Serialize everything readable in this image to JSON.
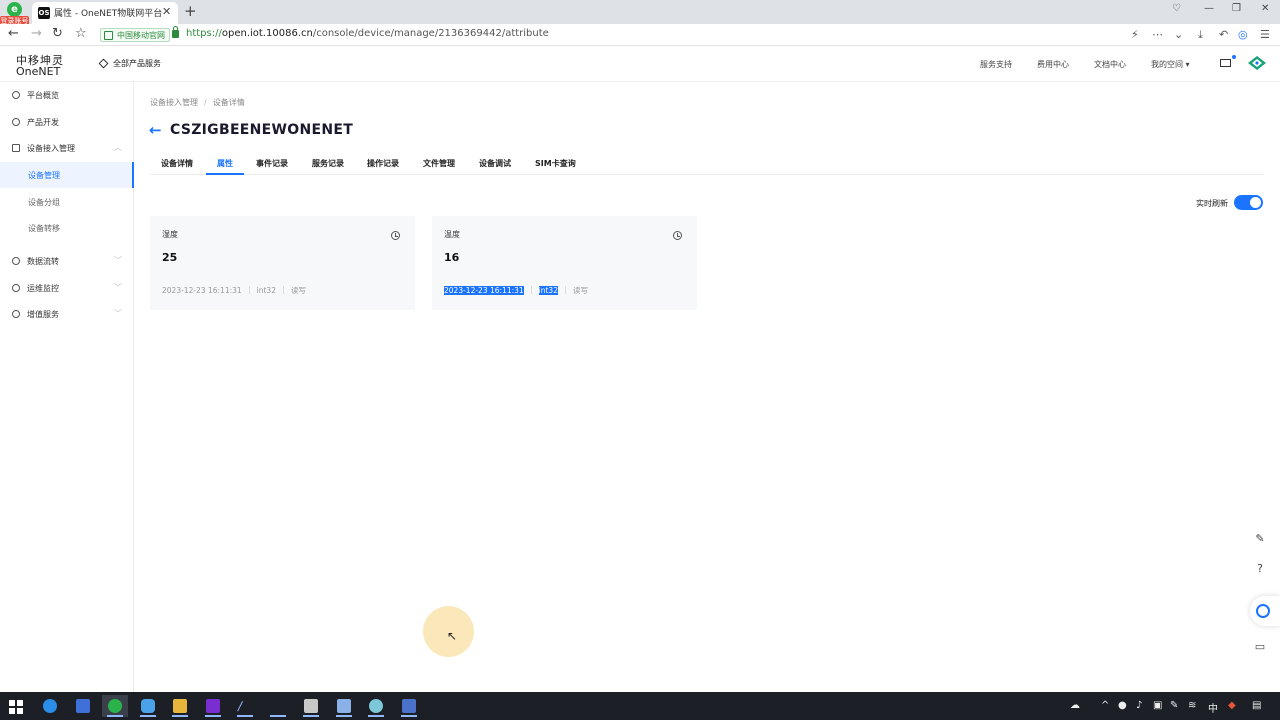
{
  "browser": {
    "login_badge": "登录账号",
    "tab_title": "属性 - OneNET物联网平台",
    "favicon_text": "OS",
    "new_tab": "+",
    "tab_close": "✕",
    "window_controls": [
      "♡",
      "—",
      "❐",
      "✕"
    ],
    "cmcc_label": "中国移动官网",
    "url_scheme": "https://",
    "url_host": "open.iot.10086.cn",
    "url_path": "/console/device/manage/2136369442/attribute"
  },
  "header": {
    "logo_top": "中移坤灵",
    "logo_bottom": "OneNET",
    "all_products": "全部产品服务",
    "links": [
      "服务支持",
      "费用中心",
      "文档中心",
      "我的空间 ▾"
    ]
  },
  "sidebar": {
    "items": [
      {
        "label": "平台概览",
        "icon": "dashboard-icon"
      },
      {
        "label": "产品开发",
        "icon": "product-icon"
      },
      {
        "label": "设备接入管理",
        "icon": "device-icon",
        "expanded": true
      },
      {
        "label": "数据流转",
        "icon": "data-flow-icon"
      },
      {
        "label": "运维监控",
        "icon": "monitor-icon"
      },
      {
        "label": "增值服务",
        "icon": "value-added-icon"
      }
    ],
    "sub_items": [
      {
        "label": "设备管理",
        "active": true
      },
      {
        "label": "设备分组",
        "active": false
      },
      {
        "label": "设备转移",
        "active": false
      }
    ]
  },
  "breadcrumb": {
    "parent": "设备接入管理",
    "sep": "/",
    "current": "设备详情"
  },
  "device": {
    "name": "CSZIGBEENEWONENET"
  },
  "tabs": [
    "设备详情",
    "属性",
    "事件记录",
    "服务记录",
    "操作记录",
    "文件管理",
    "设备调试",
    "SIM卡查询"
  ],
  "active_tab": "属性",
  "realtime": {
    "label": "实时刷新",
    "enabled": true
  },
  "properties": [
    {
      "name": "湿度",
      "value": "25",
      "time": "2023-12-23 16:11:31",
      "type": "int32",
      "access": "读写"
    },
    {
      "name": "温度",
      "value": "16",
      "time": "2023-12-23 16:11:31",
      "type": "int32",
      "access": "读写"
    }
  ],
  "float_tools": [
    "edit-icon",
    "help-icon",
    "service-icon",
    "message-icon"
  ],
  "taskbar": {
    "tray_lang": "中"
  }
}
